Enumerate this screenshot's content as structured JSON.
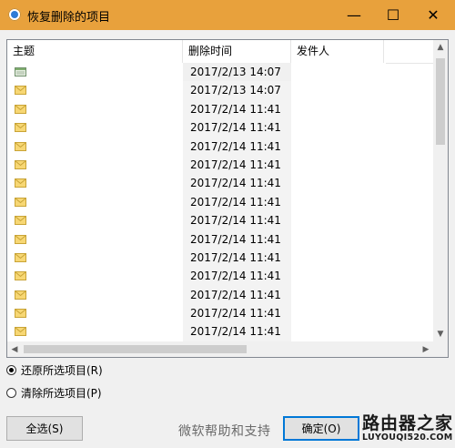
{
  "window": {
    "title": "恢复删除的项目",
    "minimize_glyph": "—",
    "maximize_glyph": "☐",
    "close_glyph": "✕"
  },
  "list": {
    "columns": [
      "主题",
      "删除时间",
      "发件人"
    ],
    "rows": [
      {
        "icon": "calendar-icon",
        "time": "2017/2/13 14:07",
        "selected": true
      },
      {
        "icon": "mail-icon",
        "time": "2017/2/13 14:07"
      },
      {
        "icon": "mail-icon",
        "time": "2017/2/14 11:41"
      },
      {
        "icon": "mail-icon",
        "time": "2017/2/14 11:41"
      },
      {
        "icon": "mail-icon",
        "time": "2017/2/14 11:41"
      },
      {
        "icon": "mail-icon",
        "time": "2017/2/14 11:41"
      },
      {
        "icon": "mail-icon",
        "time": "2017/2/14 11:41"
      },
      {
        "icon": "mail-icon",
        "time": "2017/2/14 11:41"
      },
      {
        "icon": "mail-icon",
        "time": "2017/2/14 11:41"
      },
      {
        "icon": "mail-icon",
        "time": "2017/2/14 11:41"
      },
      {
        "icon": "mail-icon",
        "time": "2017/2/14 11:41"
      },
      {
        "icon": "mail-icon",
        "time": "2017/2/14 11:41"
      },
      {
        "icon": "mail-icon",
        "time": "2017/2/14 11:41"
      },
      {
        "icon": "mail-icon",
        "time": "2017/2/14 11:41"
      },
      {
        "icon": "mail-icon",
        "time": "2017/2/14 11:41"
      }
    ]
  },
  "options": {
    "restore_label": "还原所选项目(R)",
    "purge_label": "清除所选项目(P)",
    "selected": "restore"
  },
  "buttons": {
    "select_all": "全选(S)",
    "ok": "确定(O)"
  },
  "watermark": {
    "text": "微软帮助和支持",
    "logo_main": "路由器之家",
    "logo_sub": "LUYOUQI520.COM"
  },
  "colors": {
    "titlebar": "#e8a13c",
    "accent": "#0078d7"
  }
}
